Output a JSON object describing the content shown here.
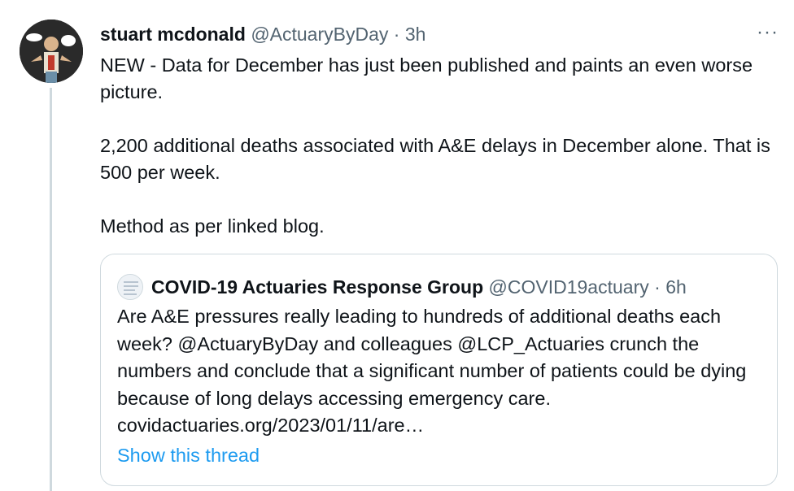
{
  "tweet": {
    "author_name": "stuart mcdonald",
    "author_handle": "@ActuaryByDay",
    "separator": "·",
    "time": "3h",
    "more_label": "···",
    "paragraphs": [
      "NEW - Data for December has just been published and paints an even worse picture.",
      "2,200 additional deaths associated with A&E delays in December alone. That is 500 per week.",
      "Method as per linked blog."
    ]
  },
  "quote": {
    "author_name": "COVID-19 Actuaries Response Group",
    "author_handle": "@COVID19actuary",
    "separator": "·",
    "time": "6h",
    "text": "Are A&E pressures really leading to hundreds of additional deaths each week? @ActuaryByDay and colleagues @LCP_Actuaries crunch the numbers and conclude that a significant number of patients could be dying because of long delays accessing emergency care. covidactuaries.org/2023/01/11/are…",
    "show_thread_label": "Show this thread"
  },
  "colors": {
    "text": "#0f1419",
    "secondary": "#536471",
    "link": "#1d9bf0",
    "border": "#cfd9de"
  },
  "icons": {
    "avatar": "cartoon-avatar-icon",
    "quote_avatar": "group-avatar-icon",
    "more": "more-options-icon"
  }
}
